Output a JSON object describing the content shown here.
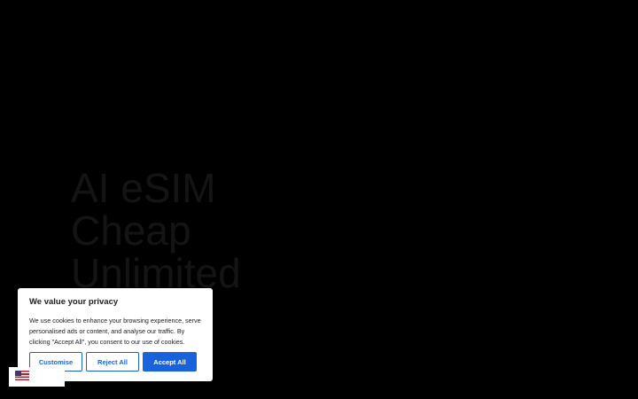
{
  "hero": {
    "title_lines": [
      "AI eSIM",
      "Cheap",
      "Unlimited"
    ]
  },
  "cookie_banner": {
    "title": "We value your privacy",
    "text": "We use cookies to enhance your browsing experience, serve personalised ads or content, and analyse our traffic. By clicking \"Accept All\", you consent to our use of cookies.",
    "customise_label": "Customise",
    "reject_label": "Reject All",
    "accept_label": "Accept All"
  },
  "language_widget": {
    "flag_icon": "us-flag-icon"
  },
  "colors": {
    "background": "#000000",
    "accent": "#1863dc",
    "banner_background": "#ffffff",
    "hero_text": "#141414"
  }
}
